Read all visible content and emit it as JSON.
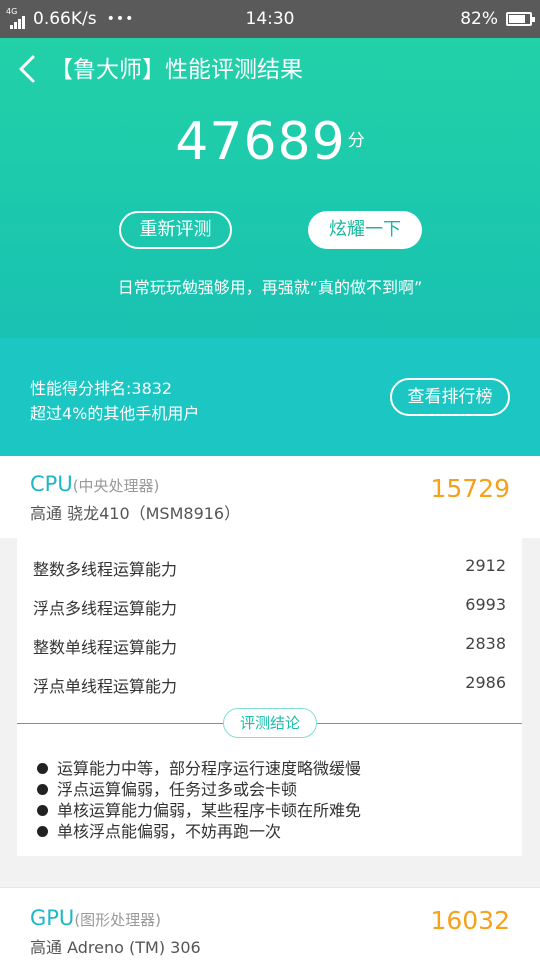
{
  "status_bar": {
    "network_type": "4G",
    "speed": "0.66K/s",
    "more": "•••",
    "time": "14:30",
    "battery_percent": "82%",
    "battery_level": 0.82
  },
  "header": {
    "title": "【鲁大师】性能评测结果"
  },
  "score": {
    "value": "47689",
    "unit": "分"
  },
  "actions": {
    "retest_label": "重新评测",
    "share_label": "炫耀一下"
  },
  "hero_comment": "日常玩玩勉强够用，再强就“真的做不到啊”",
  "rank": {
    "line1": "性能得分排名:3832",
    "line2": "超过4%的其他手机用户",
    "button_label": "查看排行榜"
  },
  "cpu": {
    "name": "CPU",
    "name_sub": "(中央处理器)",
    "chip": "高通 骁龙410（MSM8916）",
    "score": "15729",
    "metrics": [
      {
        "label": "整数多线程运算能力",
        "value": "2912"
      },
      {
        "label": "浮点多线程运算能力",
        "value": "6993"
      },
      {
        "label": "整数单线程运算能力",
        "value": "2838"
      },
      {
        "label": "浮点单线程运算能力",
        "value": "2986"
      }
    ],
    "conclusion_title": "评测结论",
    "conclusions": [
      "运算能力中等，部分程序运行速度略微缓慢",
      "浮点运算偏弱，任务过多或会卡顿",
      "单核运算能力偏弱，某些程序卡顿在所难免",
      "单核浮点能偏弱，不妨再跑一次"
    ]
  },
  "gpu": {
    "name": "GPU",
    "name_sub": "(图形处理器)",
    "chip": "高通 Adreno (TM) 306",
    "score": "16032"
  },
  "colors": {
    "hero_green": "#1cc8ad",
    "rank_teal": "#1cc6c2",
    "score_orange": "#f5a11c",
    "section_blue": "#1cb8c8"
  }
}
